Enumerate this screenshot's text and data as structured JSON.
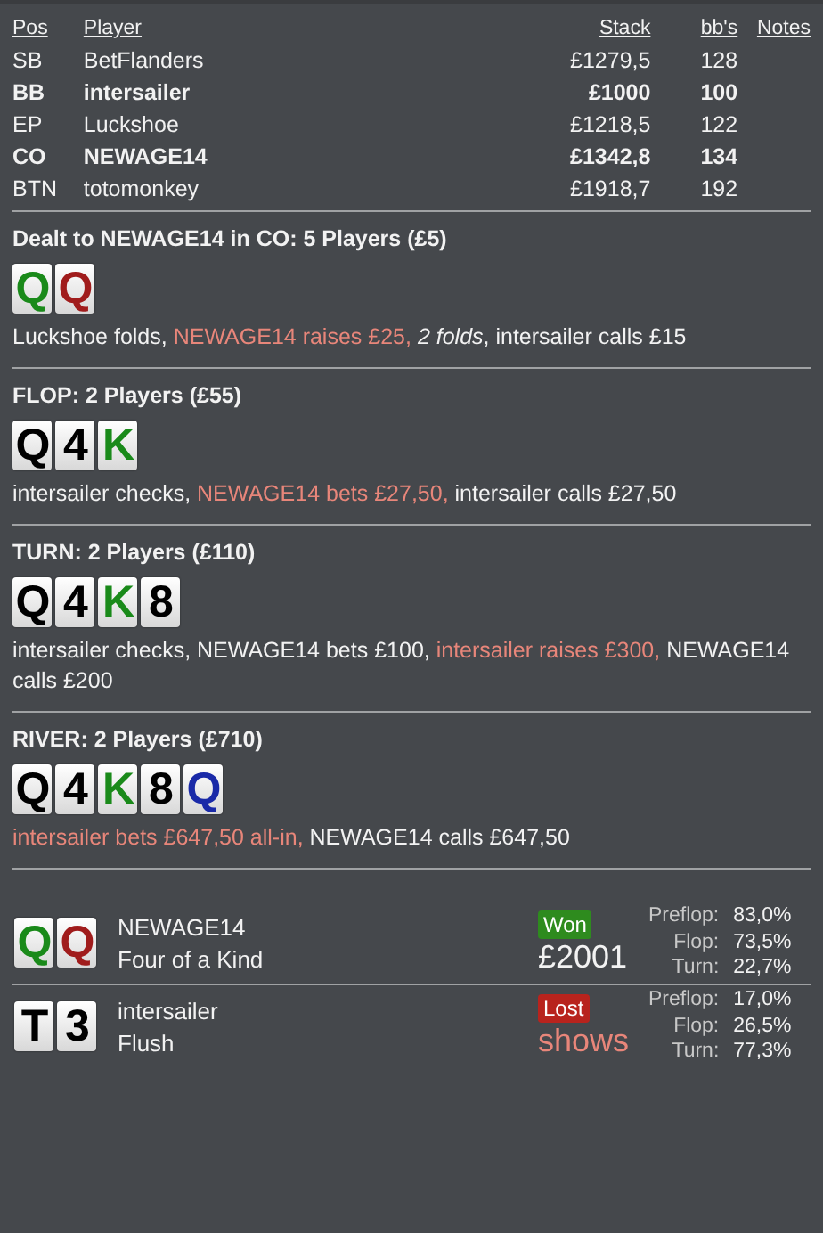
{
  "players_table": {
    "columns": [
      "Pos",
      "Player",
      "Stack",
      "bb's",
      "Notes"
    ],
    "rows": [
      {
        "pos": "SB",
        "player": "BetFlanders",
        "stack": "£1279,5",
        "bbs": "128",
        "in_hand": false
      },
      {
        "pos": "BB",
        "player": "intersailer",
        "stack": "£1000",
        "bbs": "100",
        "in_hand": true
      },
      {
        "pos": "EP",
        "player": "Luckshoe",
        "stack": "£1218,5",
        "bbs": "122",
        "in_hand": false
      },
      {
        "pos": "CO",
        "player": "NEWAGE14",
        "stack": "£1342,8",
        "bbs": "134",
        "in_hand": true
      },
      {
        "pos": "BTN",
        "player": "totomonkey",
        "stack": "£1918,7",
        "bbs": "192",
        "in_hand": false
      }
    ]
  },
  "streets": [
    {
      "title": "Dealt to NEWAGE14 in CO: 5 Players (£5)",
      "cards": [
        {
          "rank": "Q",
          "color": "#1a8a1a"
        },
        {
          "rank": "Q",
          "color": "#a01c1c"
        }
      ],
      "actions": [
        {
          "text": "Luckshoe folds, ",
          "kind": "plain"
        },
        {
          "text": "NEWAGE14 raises £25, ",
          "kind": "aggressive"
        },
        {
          "text": "2 folds",
          "kind": "italic"
        },
        {
          "text": ", intersailer calls £15",
          "kind": "plain"
        }
      ]
    },
    {
      "title": "FLOP: 2 Players (£55)",
      "cards": [
        {
          "rank": "Q",
          "color": "#000000"
        },
        {
          "rank": "4",
          "color": "#000000"
        },
        {
          "rank": "K",
          "color": "#1a8a1a"
        }
      ],
      "actions": [
        {
          "text": "intersailer checks, ",
          "kind": "plain"
        },
        {
          "text": "NEWAGE14 bets £27,50, ",
          "kind": "aggressive"
        },
        {
          "text": "intersailer calls £27,50",
          "kind": "plain"
        }
      ]
    },
    {
      "title": "TURN: 2 Players (£110)",
      "cards": [
        {
          "rank": "Q",
          "color": "#000000"
        },
        {
          "rank": "4",
          "color": "#000000"
        },
        {
          "rank": "K",
          "color": "#1a8a1a"
        },
        {
          "rank": "8",
          "color": "#000000"
        }
      ],
      "actions": [
        {
          "text": "intersailer checks, NEWAGE14 bets £100, ",
          "kind": "plain"
        },
        {
          "text": "intersailer raises £300, ",
          "kind": "aggressive"
        },
        {
          "text": "NEWAGE14 calls £200",
          "kind": "plain"
        }
      ]
    },
    {
      "title": "RIVER: 2 Players (£710)",
      "cards": [
        {
          "rank": "Q",
          "color": "#000000"
        },
        {
          "rank": "4",
          "color": "#000000"
        },
        {
          "rank": "K",
          "color": "#1a8a1a"
        },
        {
          "rank": "8",
          "color": "#000000"
        },
        {
          "rank": "Q",
          "color": "#1a2aa8"
        }
      ],
      "actions": [
        {
          "text": "intersailer bets £647,50 all-in, ",
          "kind": "aggressive"
        },
        {
          "text": "NEWAGE14 calls £647,50",
          "kind": "plain"
        }
      ]
    }
  ],
  "results": [
    {
      "cards": [
        {
          "rank": "Q",
          "color": "#1a8a1a"
        },
        {
          "rank": "Q",
          "color": "#a01c1c"
        }
      ],
      "player": "NEWAGE14",
      "hand": "Four of a Kind",
      "kind": "win",
      "badge": "Won",
      "amount": "£2001",
      "equities": [
        {
          "label": "Preflop:",
          "value": "83,0%"
        },
        {
          "label": "Flop:",
          "value": "73,5%"
        },
        {
          "label": "Turn:",
          "value": "22,7%"
        }
      ]
    },
    {
      "cards": [
        {
          "rank": "T",
          "color": "#000000"
        },
        {
          "rank": "3",
          "color": "#000000"
        }
      ],
      "player": "intersailer",
      "hand": "Flush",
      "kind": "loss",
      "badge": "Lost",
      "amount": "shows",
      "equities": [
        {
          "label": "Preflop:",
          "value": "17,0%"
        },
        {
          "label": "Flop:",
          "value": "26,5%"
        },
        {
          "label": "Turn:",
          "value": "77,3%"
        }
      ]
    }
  ]
}
